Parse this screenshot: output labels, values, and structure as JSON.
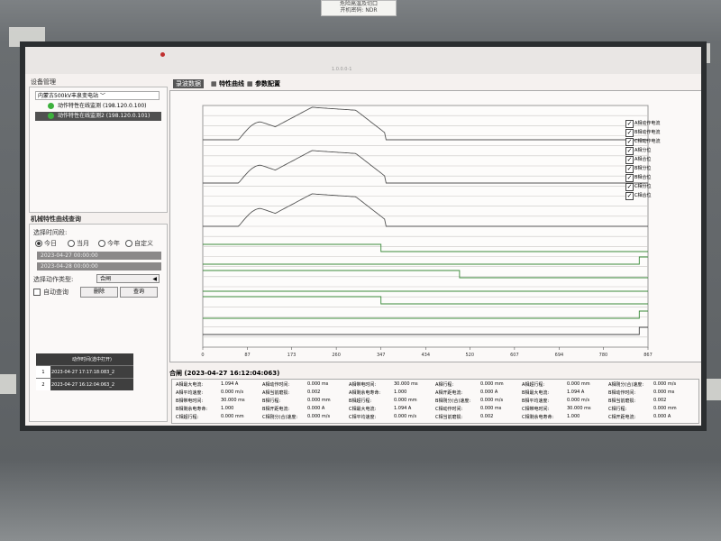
{
  "sticker": {
    "line1": "危险高温及切口",
    "line2": "开机密码: NDR"
  },
  "window": {
    "title": "1.0.0.0-1"
  },
  "left": {
    "device_title": "设备管理",
    "station": "内蒙古500kV丰泉变电站",
    "devices": [
      {
        "label": "动作特性在线监测",
        "ip": "(198.120.0.100)",
        "selected": false
      },
      {
        "label": "动作特性在线监测2",
        "ip": "(198.120.0.101)",
        "selected": true
      }
    ],
    "query_title": "机械特性曲线查询",
    "time_range_label": "选择时间段:",
    "ranges": [
      "今日",
      "当月",
      "今年",
      "自定义"
    ],
    "date_from": "2023-04-27 00:00:00",
    "date_to": "2023-04-28 00:00:00",
    "action_type_label": "选择动作类型:",
    "action_type_value": "合闸",
    "auto_query": "自动查询",
    "delete_btn": "删除",
    "query_btn": "查询",
    "table_header": "动作时间(选中打开)",
    "rows": [
      {
        "n": "1",
        "time": "2023-04-27 17:17:18:083_2"
      },
      {
        "n": "2",
        "time": "2023-04-27 16:12:04:063_2"
      }
    ]
  },
  "tabs": [
    "录波数据",
    "特性曲线",
    "参数配置"
  ],
  "chart_data": {
    "type": "line",
    "x_ticks": [
      "0",
      "87",
      "173",
      "260",
      "347",
      "434",
      "520",
      "607",
      "694",
      "780",
      "867"
    ],
    "xlim": [
      0,
      867
    ],
    "grid": true,
    "series_order_note": "",
    "legend": [
      "A相动作电流",
      "B相动作电流",
      "C相动作电流",
      "A相分位",
      "A相合位",
      "B相分位",
      "B相合位",
      "C相分位",
      "C相合位"
    ]
  },
  "stats": {
    "title": "合闸 (2023-04-27 16:12:04:063)",
    "cells": [
      [
        "A相最大电流:",
        "1.094 A",
        "A相动作时间:",
        "0.000 ms",
        "A相带电时间:",
        "30.000 ms",
        "A相行程:",
        "0.000 mm",
        "A相超行程:",
        "0.000 mm",
        "A相刚分(合)速度:",
        "0.000 m/s"
      ],
      [
        "A相平均速度:",
        "0.000 m/s",
        "A相当前磨损:",
        "0.002",
        "A相剩余电寿命:",
        "1.000",
        "A相开距电流:",
        "0.000 A",
        "B相最大电流:",
        "1.094 A",
        "B相动作时间:",
        "0.000 ms"
      ],
      [
        "B相带电时间:",
        "30.000 ms",
        "B相行程:",
        "0.000 mm",
        "B相超行程:",
        "0.000 mm",
        "B相刚分(合)速度:",
        "0.000 m/s",
        "B相平均速度:",
        "0.000 m/s",
        "B相当前磨损:",
        "0.002"
      ],
      [
        "B相剩余电寿命:",
        "1.000",
        "B相开距电流:",
        "0.000 A",
        "C相最大电流:",
        "1.094 A",
        "C相动作时间:",
        "0.000 ms",
        "C相带电时间:",
        "30.000 ms",
        "C相行程:",
        "0.000 mm"
      ],
      [
        "C相超行程:",
        "0.000 mm",
        "C相刚分(合)速度:",
        "0.000 m/s",
        "C相平均速度:",
        "0.000 m/s",
        "C相当前磨损:",
        "0.002",
        "C相剩余电寿命:",
        "1.000",
        "C相开距电流:",
        "0.000 A"
      ]
    ]
  }
}
